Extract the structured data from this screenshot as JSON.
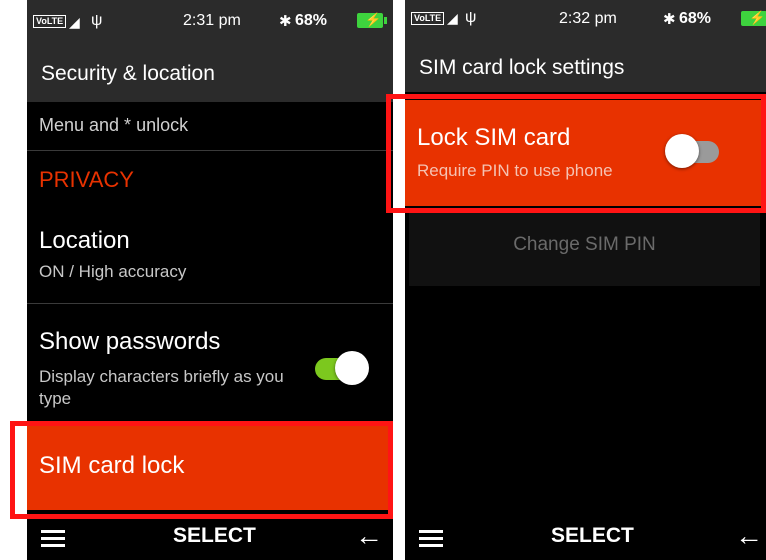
{
  "left": {
    "status": {
      "volte": "VoLTE",
      "time": "2:31 pm",
      "battery": "68%"
    },
    "title": "Security & location",
    "menu_unlock": "Menu and * unlock",
    "privacy_header": "PRIVACY",
    "location": {
      "title": "Location",
      "subtitle": "ON / High accuracy"
    },
    "show_passwords": {
      "title": "Show passwords",
      "subtitle": "Display characters briefly as you type",
      "enabled": true
    },
    "sim_card_lock": "SIM card lock",
    "softkeys": {
      "center": "SELECT"
    }
  },
  "right": {
    "status": {
      "volte": "VoLTE",
      "time": "2:32 pm",
      "battery": "68%"
    },
    "title": "SIM card lock settings",
    "lock_sim": {
      "title": "Lock SIM card",
      "subtitle": "Require PIN to use phone",
      "enabled": false
    },
    "change_pin": "Change SIM PIN",
    "softkeys": {
      "center": "SELECT"
    }
  },
  "colors": {
    "accent": "#e83200",
    "highlight_outline": "#ff1414",
    "toggle_on": "#7cc81e",
    "toggle_off": "#9a9a9a",
    "bar_bg": "#2b2b2b"
  },
  "icons": [
    "signal-icon",
    "usb-icon",
    "bluetooth-icon",
    "battery-icon",
    "menu-icon",
    "back-arrow-icon"
  ]
}
